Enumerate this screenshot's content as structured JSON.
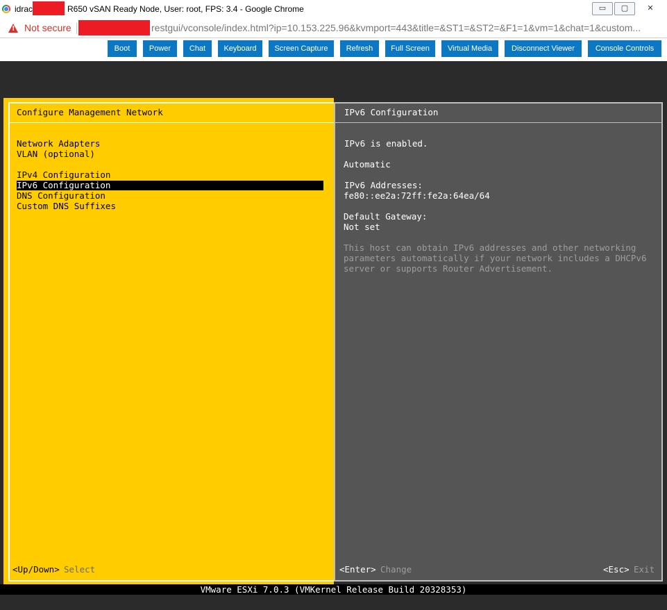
{
  "window": {
    "title_prefix": "idrac",
    "title_suffix": "R650 vSAN Ready Node, User: root, FPS: 3.4 - Google Chrome",
    "buttons": [
      "▭",
      "▢",
      "✕"
    ]
  },
  "address": {
    "security_label": "Not secure",
    "url_visible": "restgui/vconsole/index.html?ip=10.153.225.96&kvmport=443&title=&ST1=&ST2=&F1=1&vm=1&chat=1&custom..."
  },
  "toolbar": {
    "buttons": [
      "Boot",
      "Power",
      "Chat",
      "Keyboard",
      "Screen Capture",
      "Refresh",
      "Full Screen",
      "Virtual Media",
      "Disconnect Viewer",
      "Console Controls"
    ],
    "color": "#0c78c4"
  },
  "esxi": {
    "left_title": "Configure Management Network",
    "menu_group1": [
      "Network Adapters",
      "VLAN (optional)"
    ],
    "menu_group2": [
      "IPv4 Configuration",
      "IPv6 Configuration",
      "DNS Configuration",
      "Custom DNS Suffixes"
    ],
    "selected_item": "IPv6 Configuration",
    "right_title": "IPv6 Configuration",
    "status_line": "IPv6 is enabled.",
    "mode": "Automatic",
    "addresses_label": "IPv6 Addresses:",
    "address_value": "fe80::ee2a:72ff:fe2a:64ea/64",
    "gateway_label": "Default Gateway:",
    "gateway_value": "Not set",
    "description": [
      "This host can obtain IPv6 addresses and other networking",
      "parameters automatically if your network includes a DHCPv6",
      "server or supports Router Advertisement."
    ],
    "footer_left_key": "<Up/Down>",
    "footer_left_action": "Select",
    "footer_mid_key": "<Enter>",
    "footer_mid_action": "Change",
    "footer_right_key": "<Esc>",
    "footer_right_action": "Exit",
    "version_line": "VMware ESXi 7.0.3 (VMKernel Release Build 20328353)",
    "colors": {
      "yellow": "#ffcc00",
      "gray": "#555555"
    }
  }
}
